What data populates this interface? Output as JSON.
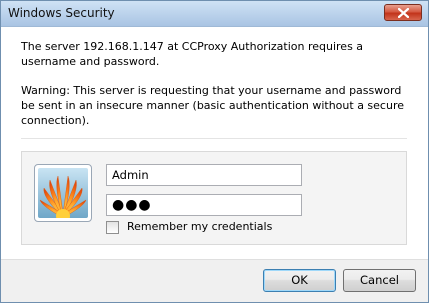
{
  "window": {
    "title": "Windows Security",
    "close_icon": "close-icon"
  },
  "message": {
    "line1": "The server 192.168.1.147 at CCProxy Authorization requires a username and password.",
    "warning": "Warning: This server is requesting that your username and password be sent in an insecure manner (basic authentication without a secure connection)."
  },
  "credentials": {
    "avatar_icon": "flower-avatar-icon",
    "username_value": "Admin",
    "password_mask": "●●●",
    "remember_label": "Remember my credentials",
    "remember_checked": false
  },
  "buttons": {
    "ok_label": "OK",
    "cancel_label": "Cancel"
  },
  "colors": {
    "titlebar": "#bcd3ec",
    "close_button": "#c2341b",
    "default_button_border": "#3c7fb1"
  }
}
